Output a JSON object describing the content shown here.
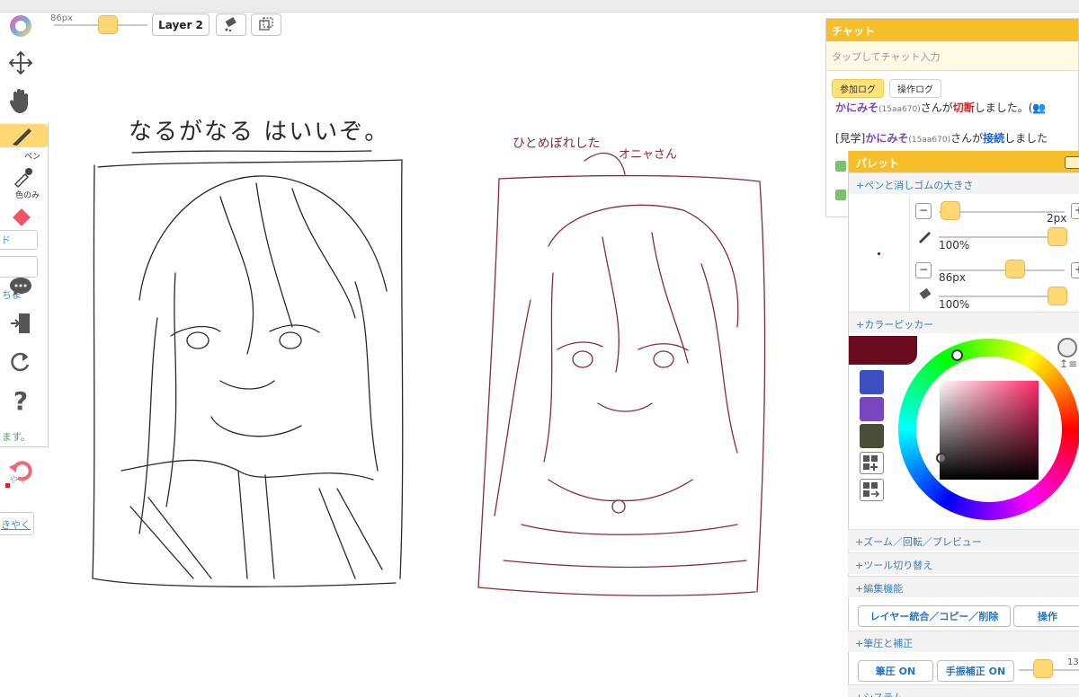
{
  "toolbar": {
    "brush_size_label": "86px",
    "brush_size_value": 86,
    "layer_label": "Layer 2"
  },
  "tools": {
    "pen_label": "ペン",
    "picker_label": "色のみ",
    "left_fragments": [
      "ド",
      "ちま",
      "ます。",
      "やく",
      "きやく"
    ]
  },
  "sketch_captions": {
    "left": "なるがなる はいいぞ。",
    "right_top": "ひとめぼれした",
    "right_sub": "オニャさん"
  },
  "chat": {
    "title": "チャット",
    "input_placeholder": "タップしてチャット入力",
    "tabs": [
      {
        "label": "参加ログ",
        "active": true
      },
      {
        "label": "操作ログ",
        "active": false
      }
    ],
    "messages": [
      {
        "prefix": "",
        "user": "かにみそ",
        "uid": "(15aa670)",
        "text1": "さんが",
        "action": "切断",
        "text2": "しました。(👥"
      },
      {
        "prefix": "[見学]",
        "user": "かにみそ",
        "uid": "(15aa670)",
        "text1": "さんが",
        "action": "接続",
        "text2": "しました"
      }
    ]
  },
  "palette": {
    "title": "パレット",
    "sections": {
      "pen_eraser_size": "+ペンと消しゴムの大きさ",
      "color_picker": "+カラーピッカー",
      "zoom": "+ズーム／回転／プレビュー",
      "tool_switch": "+ツール切り替え",
      "edit": "+編集機能",
      "pressure": "+筆圧と補正",
      "system": "+システム"
    },
    "pen_size": "2px",
    "pen_opacity": "100%",
    "eraser_size": "86px",
    "eraser_opacity": "100%",
    "edit_button": "レイヤー統合／コピー／削除",
    "operation_button": "操作",
    "pressure_button": "筆圧 ON",
    "stabilizer_button": "手振補正 ON",
    "stabilizer_value": "13",
    "current_color": "#6a0a1f",
    "swatches": [
      "#3d4fc0",
      "#7a46bf",
      "#4a4d38"
    ]
  }
}
